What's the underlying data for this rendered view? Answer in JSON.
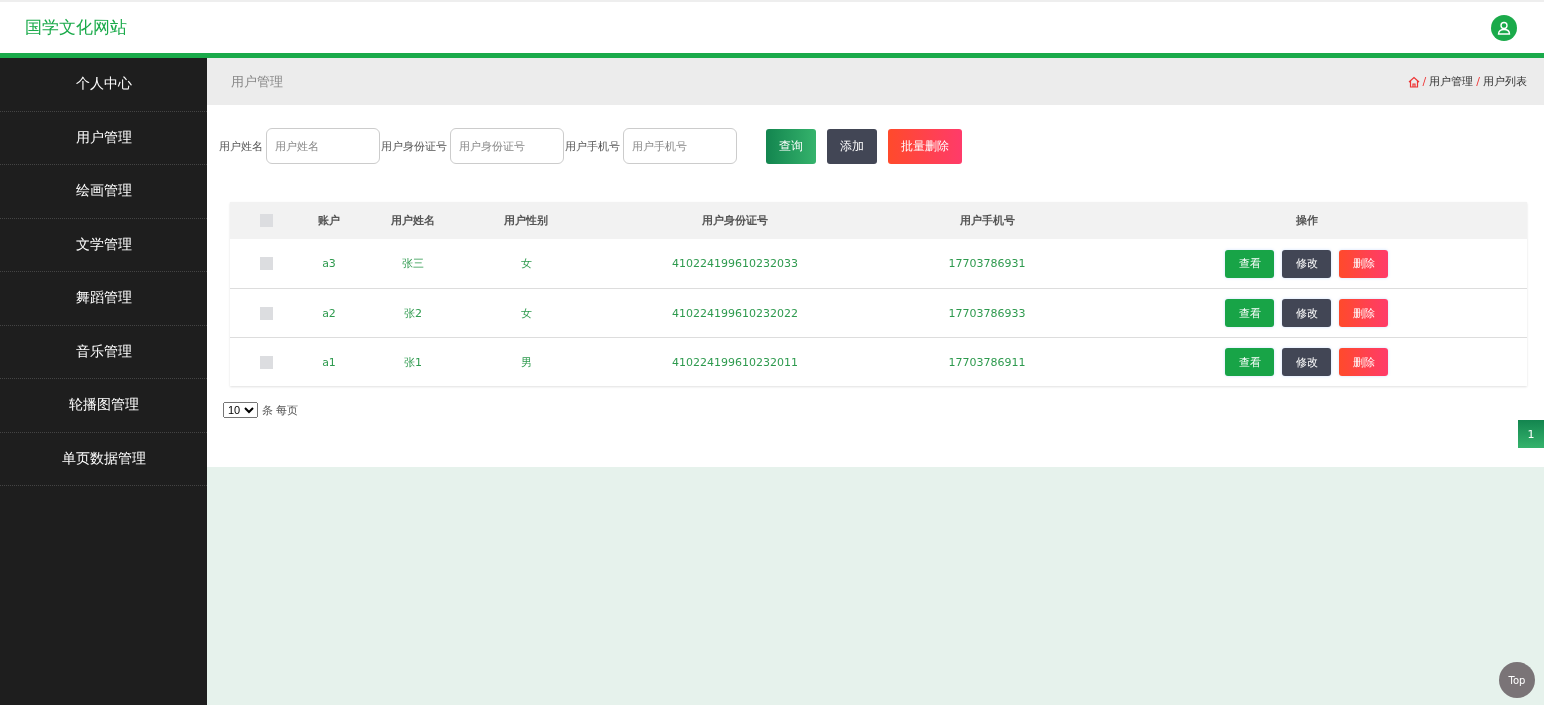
{
  "header": {
    "site_title": "国学文化网站"
  },
  "sidebar": {
    "items": [
      {
        "label": "个人中心",
        "selected": false
      },
      {
        "label": "用户管理",
        "selected": false
      },
      {
        "label": "绘画管理",
        "selected": false
      },
      {
        "label": "文学管理",
        "selected": false
      },
      {
        "label": "舞蹈管理",
        "selected": false
      },
      {
        "label": "音乐管理",
        "selected": false
      },
      {
        "label": "轮播图管理",
        "selected": false
      },
      {
        "label": "单页数据管理",
        "selected": false
      }
    ]
  },
  "page_title": "用户管理",
  "breadcrumb": [
    {
      "separator": "/",
      "label": "用户管理"
    },
    {
      "separator": "/",
      "label": "用户列表"
    }
  ],
  "filters": [
    {
      "label": "用户姓名",
      "placeholder": "用户姓名"
    },
    {
      "label": "用户身份证号",
      "placeholder": "用户身份证号"
    },
    {
      "label": "用户手机号",
      "placeholder": "用户手机号"
    }
  ],
  "actions": [
    {
      "label": "查询",
      "kind": "search"
    },
    {
      "label": "添加",
      "kind": "add"
    },
    {
      "label": "批量删除",
      "kind": "delete"
    }
  ],
  "table": {
    "all_checked": false,
    "columns": [
      "账户",
      "用户姓名",
      "用户性别",
      "用户身份证号",
      "用户手机号",
      "操作"
    ],
    "rows": [
      {
        "checked": false,
        "cells": [
          "a3",
          "张三",
          "女",
          "410224199610232033",
          "17703786931"
        ],
        "buttons": [
          {
            "label": "查看",
            "kind": "view"
          },
          {
            "label": "修改",
            "kind": "edit"
          },
          {
            "label": "删除",
            "kind": "delete"
          }
        ]
      },
      {
        "checked": false,
        "cells": [
          "a2",
          "张2",
          "女",
          "410224199610232022",
          "17703786933"
        ],
        "buttons": [
          {
            "label": "查看",
            "kind": "view"
          },
          {
            "label": "修改",
            "kind": "edit"
          },
          {
            "label": "删除",
            "kind": "delete"
          }
        ]
      },
      {
        "checked": false,
        "cells": [
          "a1",
          "张1",
          "男",
          "410224199610232011",
          "17703786911"
        ],
        "buttons": [
          {
            "label": "查看",
            "kind": "view"
          },
          {
            "label": "修改",
            "kind": "edit"
          },
          {
            "label": "删除",
            "kind": "delete"
          }
        ]
      }
    ]
  },
  "pagination": {
    "page_size": "10",
    "page_size_suffix": "条 每页",
    "pages": [
      {
        "label": "1",
        "selected": true
      }
    ]
  },
  "back_to_top": "Top"
}
